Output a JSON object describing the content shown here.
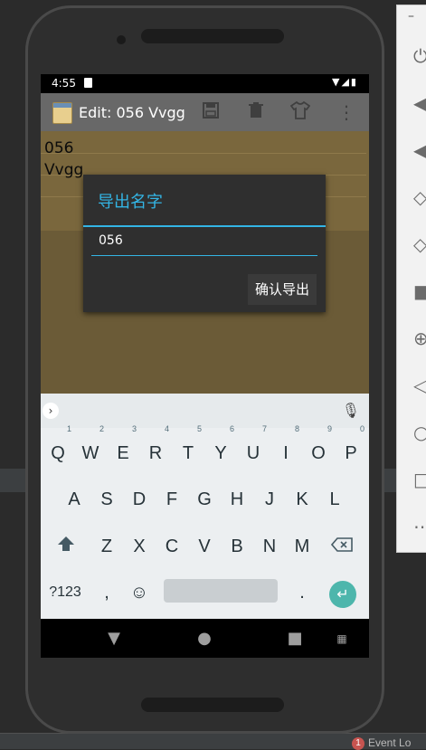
{
  "status_bar": {
    "time": "4:55",
    "icons": "▼◢▮"
  },
  "app_bar": {
    "title": "Edit: 056 Vvgg"
  },
  "note": {
    "text": "056\nVvgg"
  },
  "dialog": {
    "title": "导出名字",
    "input_value": "056",
    "confirm_label": "确认导出"
  },
  "keyboard": {
    "row1": [
      "Q",
      "W",
      "E",
      "R",
      "T",
      "Y",
      "U",
      "I",
      "O",
      "P"
    ],
    "row1_hints": [
      "1",
      "2",
      "3",
      "4",
      "5",
      "6",
      "7",
      "8",
      "9",
      "0"
    ],
    "row2": [
      "A",
      "S",
      "D",
      "F",
      "G",
      "H",
      "J",
      "K",
      "L"
    ],
    "row3": [
      "Z",
      "X",
      "C",
      "V",
      "B",
      "N",
      "M"
    ],
    "symbols_label": "?123",
    "comma": ",",
    "period": "."
  },
  "ide": {
    "event_log_label": "Event Lo",
    "event_count": "1"
  },
  "colors": {
    "accent": "#33b5e5",
    "note_bg": "#6b5b37",
    "enter": "#4db6ac"
  }
}
